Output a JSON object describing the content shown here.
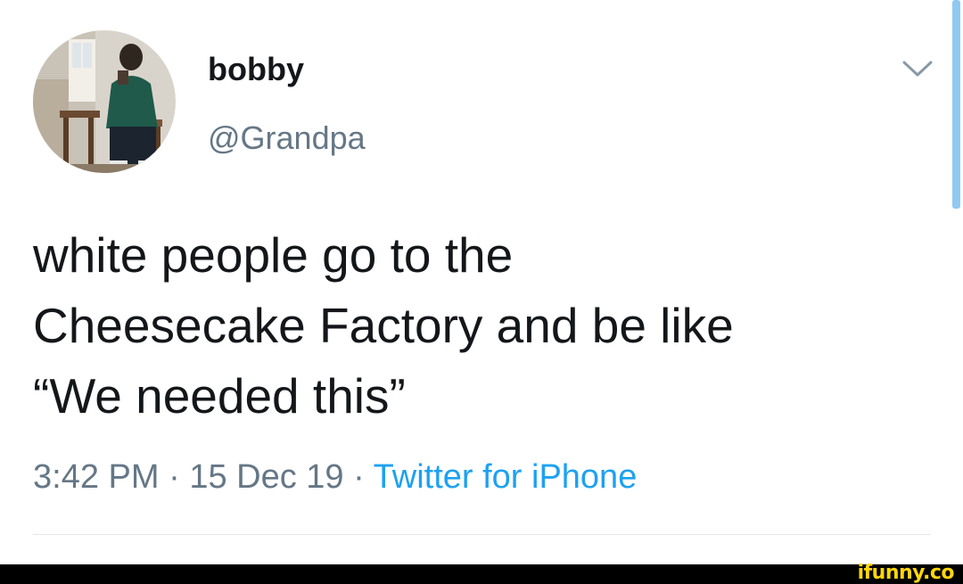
{
  "tweet": {
    "author": {
      "display_name": "bobby",
      "handle": "@Grandpa"
    },
    "text_lines": [
      "white people go to the",
      "Cheesecake Factory and be like",
      "“We needed this”"
    ],
    "meta": {
      "time": "3:42 PM",
      "separator": "·",
      "date": "15 Dec 19",
      "source": "Twitter for iPhone"
    },
    "menu_icon": "chevron-down-icon"
  },
  "watermark": {
    "text": "ifunny.co"
  },
  "colors": {
    "text_primary": "#14171a",
    "text_secondary": "#657786",
    "link": "#1da1f2",
    "watermark": "#ffd60a"
  }
}
